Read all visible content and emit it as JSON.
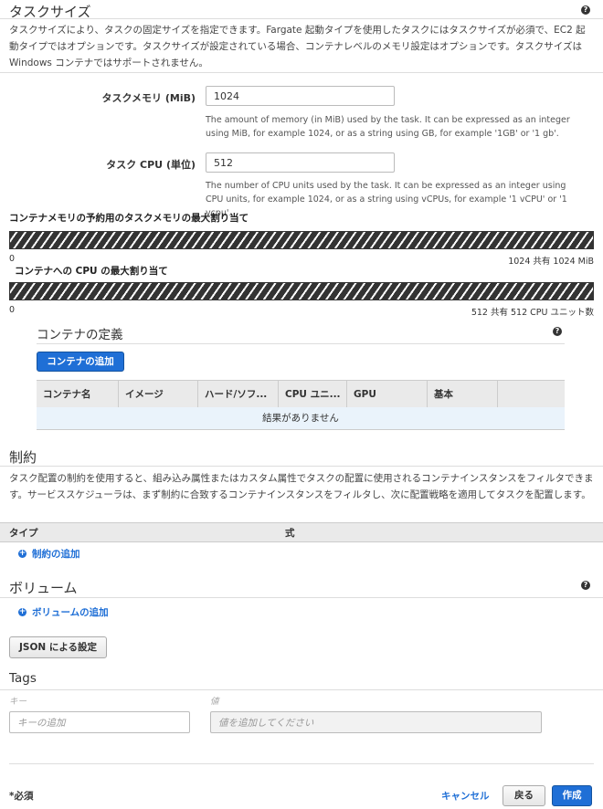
{
  "task_size": {
    "title": "タスクサイズ",
    "description": "タスクサイズにより、タスクの固定サイズを指定できます。Fargate 起動タイプを使用したタスクにはタスクサイズが必須で、EC2 起動タイプではオプションです。タスクサイズが設定されている場合、コンテナレベルのメモリ設定はオプションです。タスクサイズは Windows コンテナではサポートされません。",
    "help_icon": "?",
    "memory": {
      "label": "タスクメモリ (MiB)",
      "value": "1024",
      "hint": "The amount of memory (in MiB) used by the task. It can be expressed as an integer using MiB, for example 1024, or as a string using GB, for example '1GB' or '1 gb'."
    },
    "cpu": {
      "label": "タスク CPU (単位)",
      "value": "512",
      "hint": "The number of CPU units used by the task. It can be expressed as an integer using CPU units, for example 1024, or as a string using vCPUs, for example '1 vCPU' or '1 vcpu'."
    },
    "memory_bar": {
      "label": "コンテナメモリの予約用のタスクメモリの最大割り当て",
      "min": "0",
      "max_label": "1024 共有 1024 MiB"
    },
    "cpu_bar": {
      "label": "コンテナへの CPU の最大割り当て",
      "min": "0",
      "max_label": "512 共有 512 CPU ユニット数"
    }
  },
  "containers": {
    "title": "コンテナの定義",
    "add_button": "コンテナの追加",
    "columns": [
      "コンテナ名",
      "イメージ",
      "ハード/ソフ...",
      "CPU ユニ...",
      "GPU",
      "基本",
      ""
    ],
    "empty": "結果がありません"
  },
  "constraints": {
    "title": "制約",
    "description": "タスク配置の制約を使用すると、組み込み属性またはカスタム属性でタスクの配置に使用されるコンテナインスタンスをフィルタできます。サービススケジューラは、まず制約に合致するコンテナインスタンスをフィルタし、次に配置戦略を適用してタスクを配置します。",
    "col_type": "タイプ",
    "col_expr": "式",
    "add_link": "制約の追加"
  },
  "volumes": {
    "title": "ボリューム",
    "add_link": "ボリュームの追加"
  },
  "json_button": "JSON による設定",
  "tags": {
    "title": "Tags",
    "key_label": "キー",
    "value_label": "値",
    "key_placeholder": "キーの追加",
    "value_placeholder": "値を追加してください"
  },
  "footer": {
    "required": "*必須",
    "cancel": "キャンセル",
    "back": "戻る",
    "create": "作成"
  },
  "colors": {
    "primary": "#1f6fd6",
    "header_bg": "#eaeaea",
    "empty_row_bg": "#eaf3fb"
  }
}
